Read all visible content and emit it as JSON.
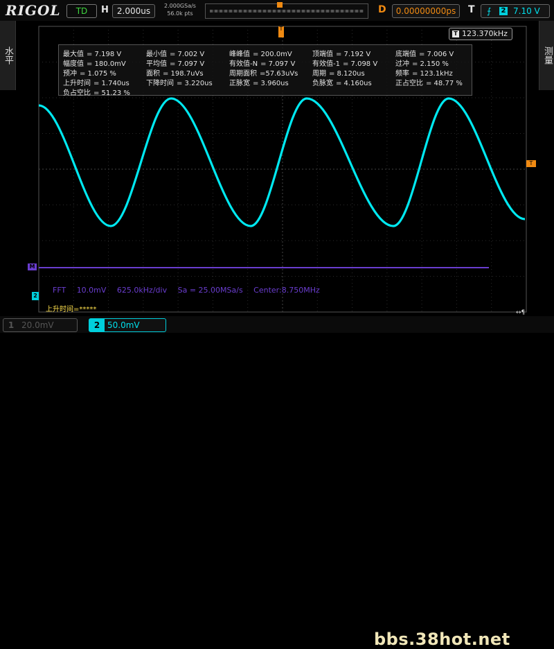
{
  "brand": "RIGOL",
  "top": {
    "run_state": "TD",
    "h_label": "H",
    "timebase": "2.000us",
    "sample_rate": "2.000GSa/s",
    "mem_depth": "56.0k pts",
    "delay_label": "D",
    "delay": "0.00000000ps",
    "trigger_label": "T",
    "trigger_channel": "2",
    "trigger_level": "7.10 V"
  },
  "side": {
    "left_label": "水平",
    "right_label": "测量"
  },
  "frequency_counter": "123.370kHz",
  "measurements": [
    [
      "最大值",
      "= 7.198 V"
    ],
    [
      "最小值",
      "= 7.002 V"
    ],
    [
      "峰峰值",
      "= 200.0mV"
    ],
    [
      "顶端值",
      "= 7.192 V"
    ],
    [
      "底端值",
      "= 7.006 V"
    ],
    [
      "幅度值",
      "= 180.0mV"
    ],
    [
      "平均值",
      "= 7.097 V"
    ],
    [
      "有效值-N",
      "= 7.097 V"
    ],
    [
      "有效值-1",
      "= 7.098 V"
    ],
    [
      "过冲",
      "= 2.150 %"
    ],
    [
      "预冲",
      "= 1.075 %"
    ],
    [
      "面积",
      "= 198.7uVs"
    ],
    [
      "周期面积",
      "=57.63uVs"
    ],
    [
      "周期",
      "= 8.120us"
    ],
    [
      "频率",
      "= 123.1kHz"
    ],
    [
      "上升时间",
      "= 1.740us"
    ],
    [
      "下降时间",
      "= 3.220us"
    ],
    [
      "正脉宽",
      "= 3.960us"
    ],
    [
      "负脉宽",
      "= 4.160us"
    ],
    [
      "正占空比",
      "= 48.77 %"
    ],
    [
      "负占空比",
      "= 51.23 %"
    ]
  ],
  "fft": {
    "label": "FFT",
    "scale": "10.0mV",
    "freq_div": "625.0kHz/div",
    "sa": "Sa = 25.00MSa/s",
    "center": "Center:8.750MHz"
  },
  "rise_hint": "上升时间=*****",
  "markers": {
    "trig_pos": "T",
    "trig_level": "T",
    "math": "M",
    "ch": "2"
  },
  "channels": [
    {
      "num": "1",
      "scale": "20.0mV"
    },
    {
      "num": "2",
      "scale": "50.0mV"
    }
  ],
  "watermark": "bbs.38hot.net",
  "colors": {
    "trace": "#00e8f0",
    "trigger": "#f08a12",
    "math": "#6a3dcf"
  }
}
